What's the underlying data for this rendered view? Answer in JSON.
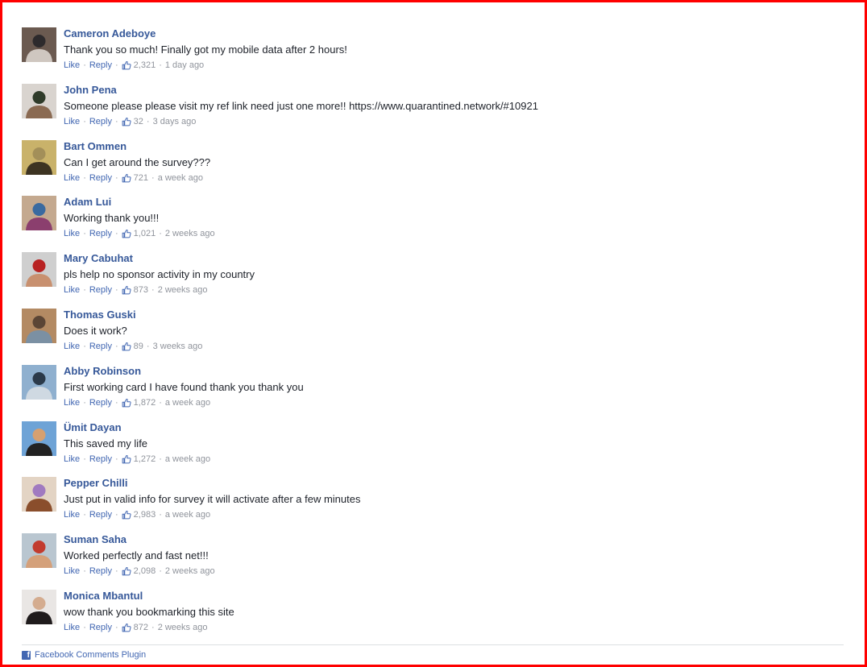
{
  "comments": [
    {
      "name": "Cameron Adeboye",
      "text": "Thank you so much! Finally got my mobile data after 2 hours!",
      "like_label": "Like",
      "reply_label": "Reply",
      "likes": "2,321",
      "time": "1 day ago",
      "avatar_colors": [
        "#6b5a50",
        "#cfc7c0",
        "#2d2a2c"
      ]
    },
    {
      "name": "John Pena",
      "text": "Someone please please visit my ref link need just one more!! https://www.quarantined.network/#10921",
      "like_label": "Like",
      "reply_label": "Reply",
      "likes": "32",
      "time": "3 days ago",
      "avatar_colors": [
        "#d9d4cf",
        "#8a6a52",
        "#2f3b2a"
      ]
    },
    {
      "name": "Bart Ommen",
      "text": "Can I get around the survey???",
      "like_label": "Like",
      "reply_label": "Reply",
      "likes": "721",
      "time": "a week ago",
      "avatar_colors": [
        "#c9b26a",
        "#3d3422",
        "#a38f59"
      ]
    },
    {
      "name": "Adam Lui",
      "text": "Working thank you!!!",
      "like_label": "Like",
      "reply_label": "Reply",
      "likes": "1,021",
      "time": "2 weeks ago",
      "avatar_colors": [
        "#c4a98f",
        "#8b3f6e",
        "#3a6aa0"
      ]
    },
    {
      "name": "Mary Cabuhat",
      "text": "pls help no sponsor activity in my country",
      "like_label": "Like",
      "reply_label": "Reply",
      "likes": "873",
      "time": "2 weeks ago",
      "avatar_colors": [
        "#cfcfcf",
        "#c8906f",
        "#b82222"
      ]
    },
    {
      "name": "Thomas Guski",
      "text": "Does it work?",
      "like_label": "Like",
      "reply_label": "Reply",
      "likes": "89",
      "time": "3 weeks ago",
      "avatar_colors": [
        "#b38a63",
        "#7b90a3",
        "#5b4535"
      ]
    },
    {
      "name": "Abby Robinson",
      "text": "First working card I have found thank you thank you",
      "like_label": "Like",
      "reply_label": "Reply",
      "likes": "1,872",
      "time": "a week ago",
      "avatar_colors": [
        "#8fb0cf",
        "#cfd9e2",
        "#2b3a4a"
      ]
    },
    {
      "name": "Ümit Dayan",
      "text": "This saved my life",
      "like_label": "Like",
      "reply_label": "Reply",
      "likes": "1,272",
      "time": "a week ago",
      "avatar_colors": [
        "#6ea3d6",
        "#222222",
        "#d6a070"
      ]
    },
    {
      "name": "Pepper Chilli",
      "text": "Just put in valid info for survey it will activate after a few minutes",
      "like_label": "Like",
      "reply_label": "Reply",
      "likes": "2,983",
      "time": "a week ago",
      "avatar_colors": [
        "#e3d4c4",
        "#8a4e2c",
        "#a07ac0"
      ]
    },
    {
      "name": "Suman Saha",
      "text": "Worked perfectly and fast net!!!",
      "like_label": "Like",
      "reply_label": "Reply",
      "likes": "2,098",
      "time": "2 weeks ago",
      "avatar_colors": [
        "#b9c6d0",
        "#d4a07a",
        "#c23b2e"
      ]
    },
    {
      "name": "Monica Mbantul",
      "text": "wow thank you bookmarking this site",
      "like_label": "Like",
      "reply_label": "Reply",
      "likes": "872",
      "time": "2 weeks ago",
      "avatar_colors": [
        "#e9e6e4",
        "#1f1b1c",
        "#d4ac8f"
      ]
    }
  ],
  "footer": {
    "plugin_label": "Facebook Comments Plugin"
  },
  "colors": {
    "name": "#365899",
    "link": "#4267b2",
    "meta": "#90949c",
    "text": "#1d2129",
    "frame": "#ff0000"
  },
  "icons": {
    "like": "thumbs-up-icon",
    "brand": "facebook-icon"
  }
}
